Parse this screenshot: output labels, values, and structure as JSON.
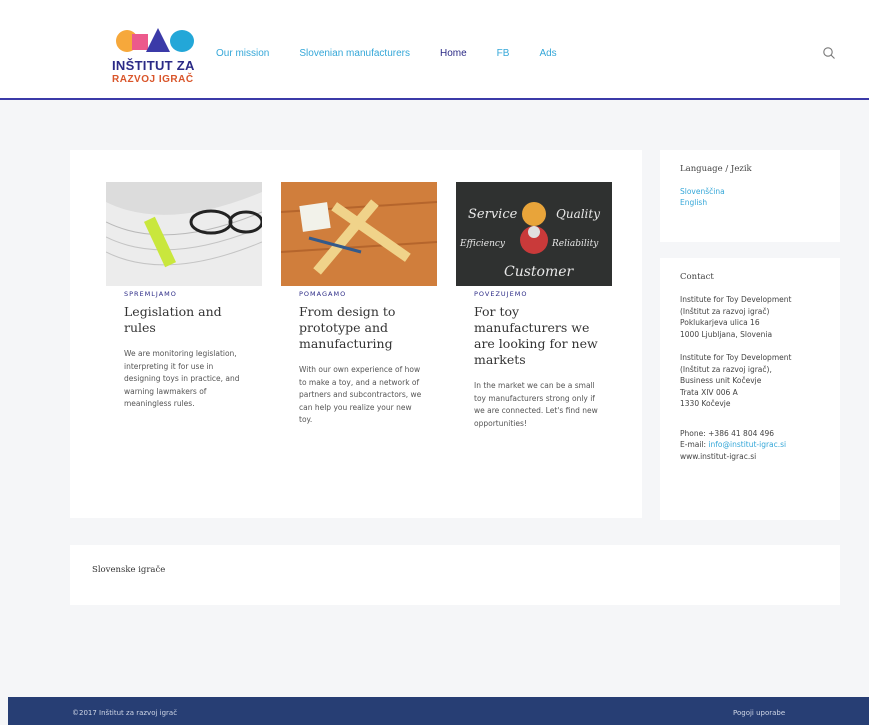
{
  "brand": {
    "logo_line1": "INŠTITUT ZA",
    "logo_line2": "RAZVOJ IGRAČ",
    "colors": {
      "accent_blue": "#35a7d8",
      "navy": "#2b2a86",
      "orange": "#f6a83b",
      "pink": "#ec5a8c",
      "cyan": "#23a7d8",
      "footer_bg": "#273e74"
    }
  },
  "nav": {
    "items": [
      {
        "label": "Our mission"
      },
      {
        "label": "Slovenian manufacturers"
      },
      {
        "label": "Home"
      },
      {
        "label": "FB"
      },
      {
        "label": "Ads"
      }
    ],
    "search_icon": "search-icon"
  },
  "cards": [
    {
      "category": "SPREMLJAMO",
      "title": "Legislation and rules",
      "text": "We are monitoring legislation, interpreting it for use in designing toys in practice, and warning lawmakers of meaningless rules."
    },
    {
      "category": "POMAGAMO",
      "title": "From design to prototype and manufacturing",
      "text": "With our own experience of how to make a toy, and a network of partners and subcontractors, we can help you realize your new toy."
    },
    {
      "category": "POVEZUJEMO",
      "title": "For toy manufacturers we are looking for new markets",
      "text": "In the market we can be a small toy manufacturers strong only if we are connected. Let's find new opportunities!",
      "image_words": {
        "service": "Service",
        "quality": "Quality",
        "efficiency": "Efficiency",
        "reliability": "Reliability",
        "customer": "Customer"
      }
    }
  ],
  "sidebar": {
    "language_heading": "Language / Jezik",
    "languages": [
      "Slovenščina",
      "English"
    ],
    "contact_heading": "Contact",
    "address1": [
      "Institute for Toy Development",
      "(Inštitut za razvoj igrač)",
      "Poklukarjeva ulica 16",
      "1000 Ljubljana, Slovenia"
    ],
    "address2": [
      "Institute for Toy Development",
      "(Inštitut za razvoj igrač),",
      "Business unit Kočevje",
      "Trata XIV 006 A",
      "1330 Kočevje"
    ],
    "phone": "Phone: +386 41 804 496",
    "email_label": "E-mail:",
    "email": "info@institut-igrac.si",
    "website": "www.institut-igrac.si"
  },
  "section": {
    "title": "Slovenske igrače"
  },
  "footer": {
    "copyright": "©2017 Inštitut za razvoj igrač",
    "terms": "Pogoji uporabe"
  }
}
